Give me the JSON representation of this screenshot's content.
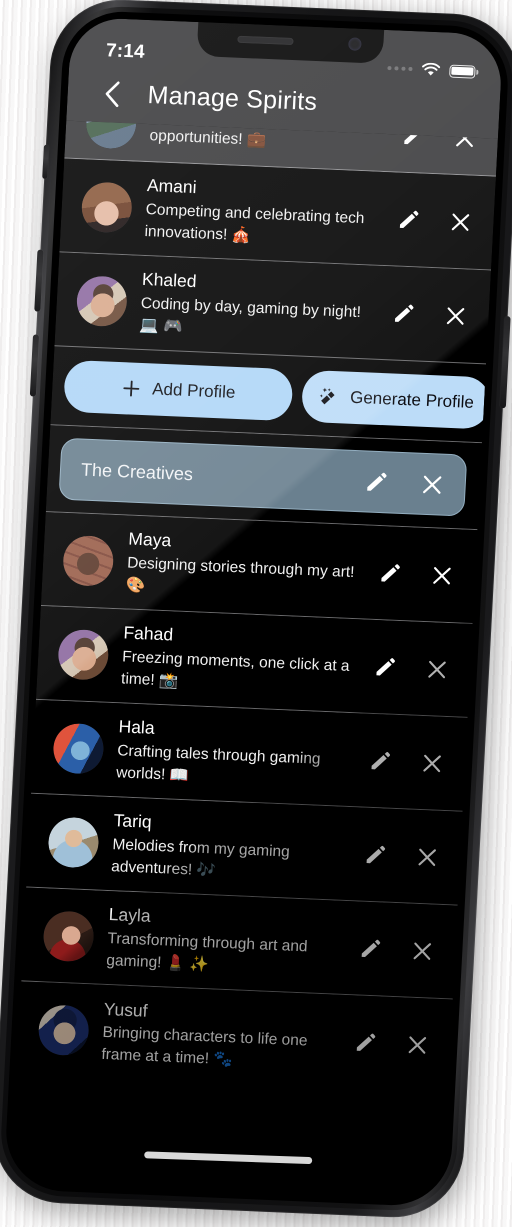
{
  "device": {
    "status_bar": {
      "time": "7:14",
      "signal_icon": "signal-dots-icon",
      "wifi_icon": "wifi-icon",
      "battery_icon": "battery-icon"
    },
    "home_indicator": "home-indicator"
  },
  "header": {
    "back_icon": "chevron-left-icon",
    "title": "Manage Spirits"
  },
  "icons": {
    "edit": "pencil-icon",
    "delete": "close-x-icon",
    "add": "plus-icon",
    "generate": "magic-wand-icon"
  },
  "colors": {
    "accent_button": "#afd6f7",
    "accent_button_alt": "#bcdcf8",
    "group_header": "#6a808f",
    "group_header_border": "#93aec0",
    "app_bar": "#3a3a3c",
    "screen_bg": "#000000",
    "row_divider": "#6a6a6c",
    "text_primary": "#ffffff"
  },
  "toolbar": {
    "add_profile_label": "Add Profile",
    "generate_profile_label": "Generate Profile"
  },
  "list": {
    "top_partial_row": {
      "name": "",
      "description": "On the hunt for tech opportunities! 💼",
      "avatar_colors": [
        "#7e93ab",
        "#3f5d45",
        "#c8b9a8"
      ]
    },
    "rows_above_buttons": [
      {
        "name": "Amani",
        "description": "Competing and celebrating tech innovations! 🎪",
        "avatar_colors": [
          "#8a5a3c",
          "#d8b49a",
          "#2a1a14"
        ]
      },
      {
        "name": "Khaled",
        "description": "Coding by day, gaming by night! 💻 🎮",
        "avatar_colors": [
          "#7b5a8e",
          "#d9a98c",
          "#3a2a33"
        ]
      }
    ],
    "group": {
      "title": "The Creatives",
      "members": [
        {
          "name": "Maya",
          "description": "Designing stories through my art! 🎨",
          "avatar_colors": [
            "#9a5f4a",
            "#52342a",
            "#2a1510"
          ]
        },
        {
          "name": "Fahad",
          "description": "Freezing moments, one click at a time! 📸",
          "avatar_colors": [
            "#7b5a8e",
            "#d9a98c",
            "#3a2a33"
          ]
        },
        {
          "name": "Hala",
          "description": "Crafting tales through gaming worlds! 📖",
          "avatar_colors": [
            "#e0533c",
            "#2b5fa8",
            "#0e1a33"
          ]
        },
        {
          "name": "Tariq",
          "description": "Melodies from my gaming adventures! 🎶",
          "avatar_colors": [
            "#b8c9d6",
            "#8a6540",
            "#5f7f99"
          ]
        },
        {
          "name": "Layla",
          "description": "Transforming through art and gaming! 💄 ✨",
          "avatar_colors": [
            "#4a2d22",
            "#d5a48c",
            "#8e1b1b"
          ]
        },
        {
          "name": "Yusuf",
          "description": "Bringing characters to life one frame at a time! 🐾",
          "avatar_colors": [
            "#1c2f6e",
            "#e0c6ae",
            "#0a1430"
          ]
        }
      ]
    }
  }
}
